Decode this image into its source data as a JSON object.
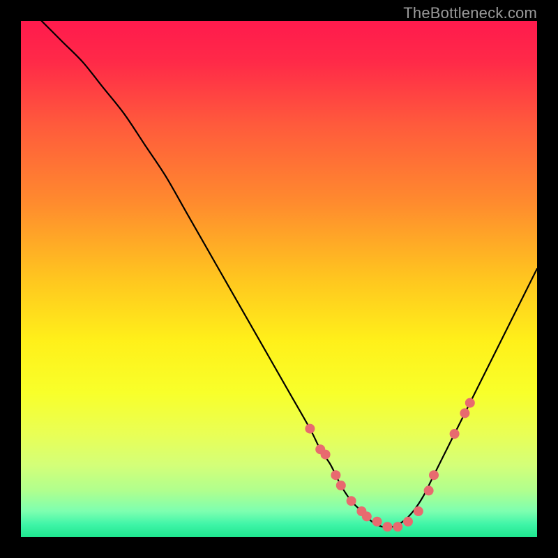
{
  "watermark": "TheBottleneck.com",
  "chart_data": {
    "type": "line",
    "title": "",
    "xlabel": "",
    "ylabel": "",
    "xlim": [
      0,
      100
    ],
    "ylim": [
      0,
      100
    ],
    "grid": false,
    "legend": false,
    "series": [
      {
        "name": "bottleneck-curve",
        "x": [
          4,
          8,
          12,
          16,
          20,
          24,
          28,
          32,
          36,
          40,
          44,
          48,
          52,
          56,
          58,
          60,
          62,
          64,
          66,
          68,
          70,
          72,
          74,
          76,
          78,
          80,
          84,
          88,
          92,
          96,
          100
        ],
        "y": [
          100,
          96,
          92,
          87,
          82,
          76,
          70,
          63,
          56,
          49,
          42,
          35,
          28,
          21,
          17,
          14,
          10,
          7,
          5,
          3,
          2,
          2,
          3,
          5,
          8,
          12,
          20,
          28,
          36,
          44,
          52
        ]
      }
    ],
    "markers": {
      "name": "highlight-points",
      "color": "#e86a6f",
      "x": [
        56,
        58,
        59,
        61,
        62,
        64,
        66,
        67,
        69,
        71,
        73,
        75,
        77,
        79,
        80,
        84,
        86,
        87
      ],
      "y": [
        21,
        17,
        16,
        12,
        10,
        7,
        5,
        4,
        3,
        2,
        2,
        3,
        5,
        9,
        12,
        20,
        24,
        26
      ]
    },
    "background_gradient": {
      "stops": [
        {
          "pos": 0.0,
          "color": "#ff1a4d"
        },
        {
          "pos": 0.08,
          "color": "#ff2a48"
        },
        {
          "pos": 0.2,
          "color": "#ff5a3c"
        },
        {
          "pos": 0.35,
          "color": "#ff8a2e"
        },
        {
          "pos": 0.5,
          "color": "#ffc61f"
        },
        {
          "pos": 0.62,
          "color": "#fff01a"
        },
        {
          "pos": 0.72,
          "color": "#f8ff2a"
        },
        {
          "pos": 0.8,
          "color": "#e9ff55"
        },
        {
          "pos": 0.86,
          "color": "#d4ff78"
        },
        {
          "pos": 0.91,
          "color": "#b0ff8e"
        },
        {
          "pos": 0.95,
          "color": "#7dffb0"
        },
        {
          "pos": 0.975,
          "color": "#40f5a8"
        },
        {
          "pos": 1.0,
          "color": "#1ee78f"
        }
      ]
    }
  }
}
